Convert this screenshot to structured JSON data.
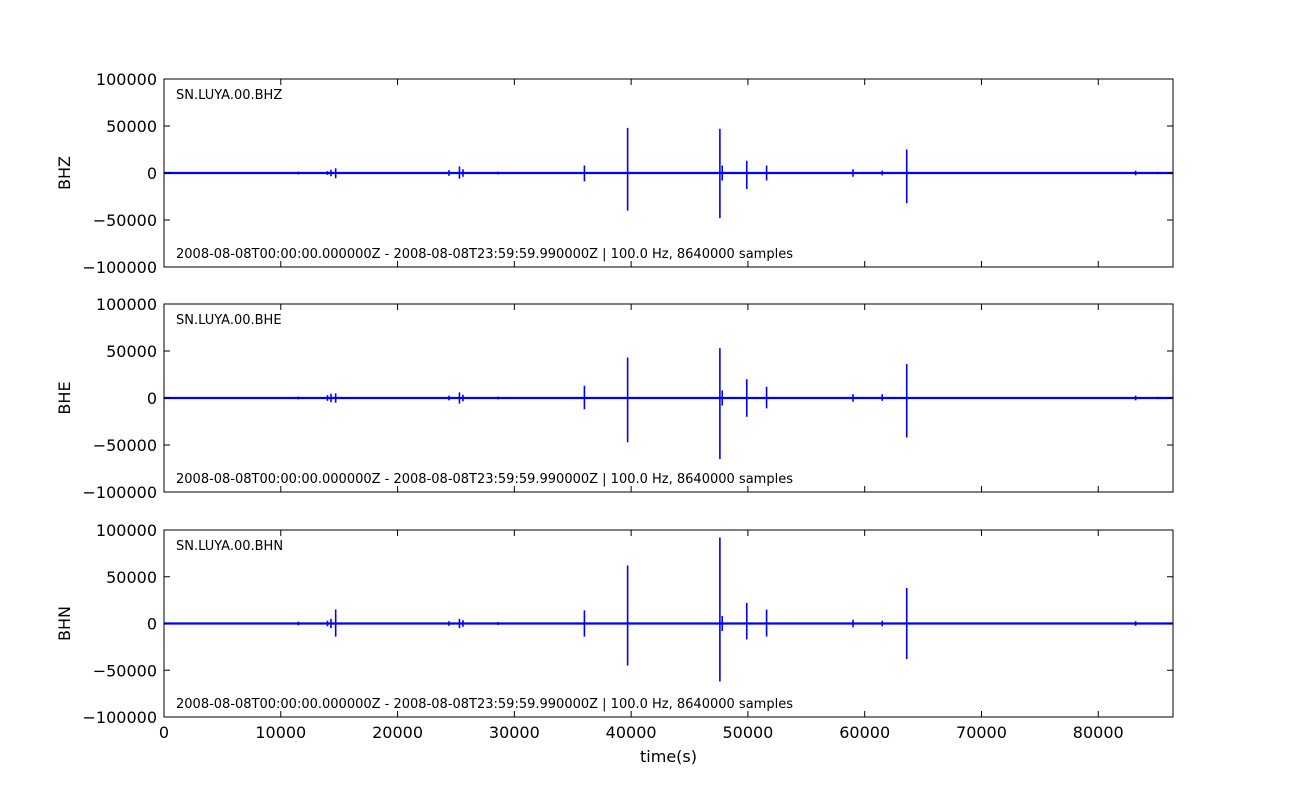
{
  "chart_data": [
    {
      "type": "line",
      "station": "SN.LUYA.00.BHZ",
      "ylabel": "BHZ",
      "info": "2008-08-08T00:00:00.000000Z - 2008-08-08T23:59:59.990000Z | 100.0 Hz, 8640000 samples",
      "ylim": [
        -100000,
        100000
      ],
      "xlim": [
        0,
        86400
      ],
      "yticks": [
        -100000,
        -50000,
        0,
        50000,
        100000
      ],
      "ytick_labels": [
        "−100000",
        "−50000",
        "0",
        "50000",
        "100000"
      ],
      "color": "#0000ff",
      "spikes": [
        {
          "x": 1800,
          "max": 1000,
          "min": -1000
        },
        {
          "x": 4600,
          "max": 800,
          "min": -800
        },
        {
          "x": 11500,
          "max": 1500,
          "min": -1500
        },
        {
          "x": 14000,
          "max": 2000,
          "min": -2000
        },
        {
          "x": 14300,
          "max": 3500,
          "min": -3500
        },
        {
          "x": 14700,
          "max": 5000,
          "min": -5500
        },
        {
          "x": 24400,
          "max": 3000,
          "min": -3000
        },
        {
          "x": 25300,
          "max": 7000,
          "min": -6000
        },
        {
          "x": 25600,
          "max": 4000,
          "min": -4000
        },
        {
          "x": 28600,
          "max": 1500,
          "min": -1500
        },
        {
          "x": 36000,
          "max": 8000,
          "min": -9000
        },
        {
          "x": 39700,
          "max": 48000,
          "min": -40000
        },
        {
          "x": 47600,
          "max": 47000,
          "min": -48000
        },
        {
          "x": 47800,
          "max": 8000,
          "min": -8000
        },
        {
          "x": 49900,
          "max": 13000,
          "min": -17000
        },
        {
          "x": 51600,
          "max": 8000,
          "min": -8000
        },
        {
          "x": 59000,
          "max": 4000,
          "min": -4000
        },
        {
          "x": 61500,
          "max": 2500,
          "min": -2500
        },
        {
          "x": 63600,
          "max": 25000,
          "min": -32000
        },
        {
          "x": 70000,
          "max": 1000,
          "min": -1000
        },
        {
          "x": 77700,
          "max": 1000,
          "min": -1000
        },
        {
          "x": 83200,
          "max": 2500,
          "min": -2500
        },
        {
          "x": 85100,
          "max": 1200,
          "min": -1200
        }
      ]
    },
    {
      "type": "line",
      "station": "SN.LUYA.00.BHE",
      "ylabel": "BHE",
      "info": "2008-08-08T00:00:00.000000Z - 2008-08-08T23:59:59.990000Z | 100.0 Hz, 8640000 samples",
      "ylim": [
        -100000,
        100000
      ],
      "xlim": [
        0,
        86400
      ],
      "yticks": [
        -100000,
        -50000,
        0,
        50000,
        100000
      ],
      "ytick_labels": [
        "−100000",
        "−50000",
        "0",
        "50000",
        "100000"
      ],
      "color": "#0000ff",
      "spikes": [
        {
          "x": 1800,
          "max": 1000,
          "min": -1000
        },
        {
          "x": 4600,
          "max": 800,
          "min": -800
        },
        {
          "x": 11500,
          "max": 1500,
          "min": -1500
        },
        {
          "x": 14000,
          "max": 3000,
          "min": -3000
        },
        {
          "x": 14300,
          "max": 4500,
          "min": -4500
        },
        {
          "x": 14700,
          "max": 5000,
          "min": -5000
        },
        {
          "x": 24400,
          "max": 2500,
          "min": -2500
        },
        {
          "x": 25300,
          "max": 6000,
          "min": -6000
        },
        {
          "x": 25600,
          "max": 3500,
          "min": -3500
        },
        {
          "x": 28600,
          "max": 1500,
          "min": -1500
        },
        {
          "x": 36000,
          "max": 13000,
          "min": -12000
        },
        {
          "x": 39700,
          "max": 43000,
          "min": -47000
        },
        {
          "x": 47600,
          "max": 53000,
          "min": -65000
        },
        {
          "x": 47800,
          "max": 8000,
          "min": -8000
        },
        {
          "x": 49900,
          "max": 20000,
          "min": -20000
        },
        {
          "x": 51600,
          "max": 12000,
          "min": -11000
        },
        {
          "x": 59000,
          "max": 4000,
          "min": -4000
        },
        {
          "x": 61500,
          "max": 4000,
          "min": -3000
        },
        {
          "x": 63600,
          "max": 36000,
          "min": -42000
        },
        {
          "x": 70000,
          "max": 1000,
          "min": -1000
        },
        {
          "x": 77700,
          "max": 1000,
          "min": -1000
        },
        {
          "x": 83200,
          "max": 2500,
          "min": -2500
        },
        {
          "x": 85100,
          "max": 1200,
          "min": -1200
        }
      ]
    },
    {
      "type": "line",
      "station": "SN.LUYA.00.BHN",
      "ylabel": "BHN",
      "info": "2008-08-08T00:00:00.000000Z - 2008-08-08T23:59:59.990000Z | 100.0 Hz, 8640000 samples",
      "xlabel": "time(s)",
      "ylim": [
        -100000,
        100000
      ],
      "xlim": [
        0,
        86400
      ],
      "yticks": [
        -100000,
        -50000,
        0,
        50000,
        100000
      ],
      "ytick_labels": [
        "−100000",
        "−50000",
        "0",
        "50000",
        "100000"
      ],
      "xticks": [
        0,
        10000,
        20000,
        30000,
        40000,
        50000,
        60000,
        70000,
        80000
      ],
      "xtick_labels": [
        "0",
        "10000",
        "20000",
        "30000",
        "40000",
        "50000",
        "60000",
        "70000",
        "80000"
      ],
      "color": "#0000ff",
      "spikes": [
        {
          "x": 1800,
          "max": 1000,
          "min": -1000
        },
        {
          "x": 4600,
          "max": 1000,
          "min": -1000
        },
        {
          "x": 11500,
          "max": 2000,
          "min": -2000
        },
        {
          "x": 14000,
          "max": 3000,
          "min": -3000
        },
        {
          "x": 14300,
          "max": 5000,
          "min": -5000
        },
        {
          "x": 14700,
          "max": 15000,
          "min": -14000
        },
        {
          "x": 24400,
          "max": 2500,
          "min": -2500
        },
        {
          "x": 25300,
          "max": 5000,
          "min": -5000
        },
        {
          "x": 25600,
          "max": 3500,
          "min": -3500
        },
        {
          "x": 28600,
          "max": 1500,
          "min": -1500
        },
        {
          "x": 36000,
          "max": 14000,
          "min": -14000
        },
        {
          "x": 39700,
          "max": 62000,
          "min": -45000
        },
        {
          "x": 47600,
          "max": 92000,
          "min": -62000
        },
        {
          "x": 47800,
          "max": 8000,
          "min": -8000
        },
        {
          "x": 49900,
          "max": 22000,
          "min": -17000
        },
        {
          "x": 51600,
          "max": 15000,
          "min": -14000
        },
        {
          "x": 59000,
          "max": 4000,
          "min": -4000
        },
        {
          "x": 61500,
          "max": 3000,
          "min": -3000
        },
        {
          "x": 63600,
          "max": 38000,
          "min": -38000
        },
        {
          "x": 70000,
          "max": 1000,
          "min": -1000
        },
        {
          "x": 77700,
          "max": 1000,
          "min": -1000
        },
        {
          "x": 83200,
          "max": 2500,
          "min": -2500
        },
        {
          "x": 85100,
          "max": 1200,
          "min": -1200
        }
      ]
    }
  ]
}
